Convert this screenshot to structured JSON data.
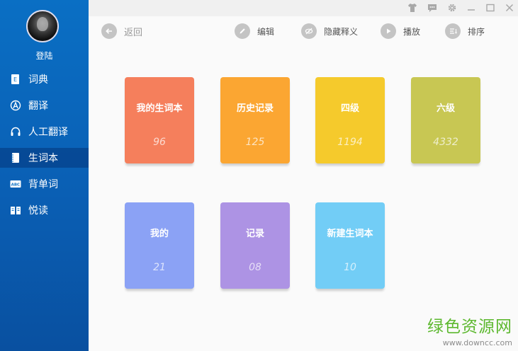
{
  "sidebar": {
    "user": {
      "login_label": "登陆"
    },
    "items": [
      {
        "label": "词典",
        "icon": "dictionary-icon"
      },
      {
        "label": "翻译",
        "icon": "translate-icon"
      },
      {
        "label": "人工翻译",
        "icon": "headset-icon"
      },
      {
        "label": "生词本",
        "icon": "notebook-icon",
        "active": true
      },
      {
        "label": "背单词",
        "icon": "abc-icon"
      },
      {
        "label": "悦读",
        "icon": "book-icon"
      }
    ]
  },
  "toolbar": {
    "back_label": "返回",
    "edit_label": "编辑",
    "hide_label": "隐藏释义",
    "play_label": "播放",
    "sort_label": "排序"
  },
  "cards": [
    {
      "title": "我的生词本",
      "count": "96",
      "color": "#f57f5c"
    },
    {
      "title": "历史记录",
      "count": "125",
      "color": "#fba632"
    },
    {
      "title": "四级",
      "count": "1194",
      "color": "#f5ca2c"
    },
    {
      "title": "六级",
      "count": "4332",
      "color": "#c8c753"
    },
    {
      "title": "我的",
      "count": "21",
      "color": "#8ba2f5"
    },
    {
      "title": "记录",
      "count": "08",
      "color": "#ad93e4"
    },
    {
      "title": "新建生词本",
      "count": "10",
      "color": "#72cdf6"
    }
  ],
  "watermark": {
    "main": "绿色资源网",
    "sub": "www.downcc.com"
  },
  "colors": {
    "sidebar": "#0a6fc4",
    "background": "#fafafa"
  }
}
